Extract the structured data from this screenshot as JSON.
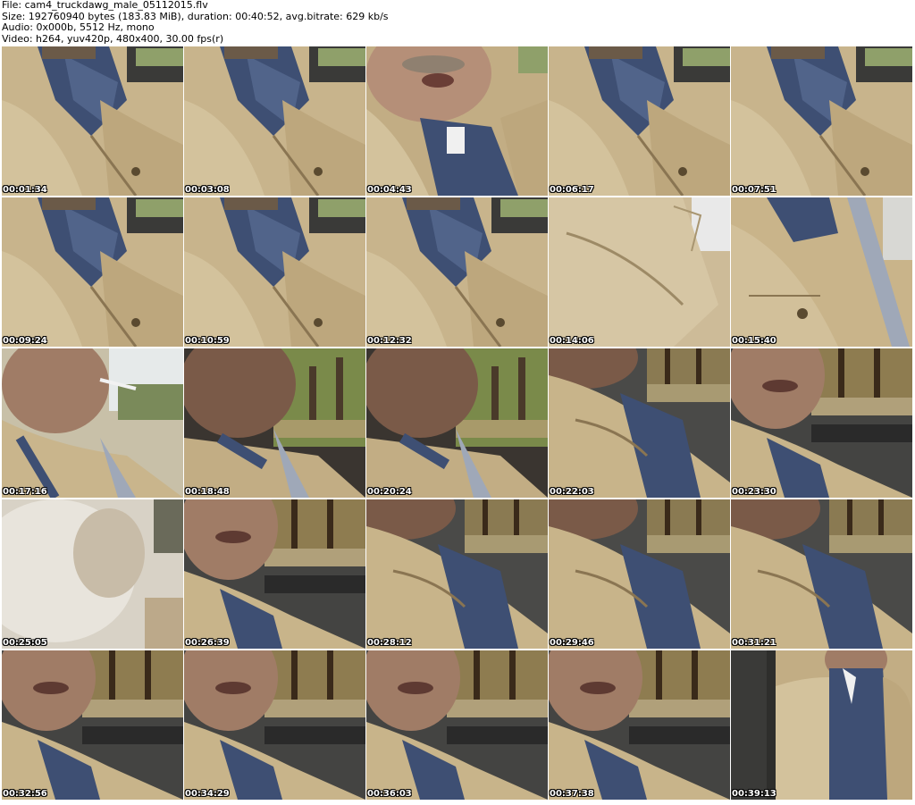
{
  "header": {
    "file_line": "File: cam4_truckdawg_male_05112015.flv",
    "size_line": "Size: 192760940 bytes (183.83 MiB), duration: 00:40:52, avg.bitrate: 629 kb/s",
    "audio_line": "Audio: 0x000b, 5512 Hz, mono",
    "video_line": "Video: h264, yuv420p, 480x400, 30.00 fps(r)"
  },
  "thumbnails": [
    {
      "time": "00:01:34",
      "scene": "jacket-window"
    },
    {
      "time": "00:03:08",
      "scene": "jacket-window"
    },
    {
      "time": "00:04:43",
      "scene": "face-jacket"
    },
    {
      "time": "00:06:17",
      "scene": "jacket-window"
    },
    {
      "time": "00:07:51",
      "scene": "jacket-window"
    },
    {
      "time": "00:09:24",
      "scene": "jacket-window"
    },
    {
      "time": "00:10:59",
      "scene": "jacket-window"
    },
    {
      "time": "00:12:32",
      "scene": "jacket-window"
    },
    {
      "time": "00:14:06",
      "scene": "jacket-close"
    },
    {
      "time": "00:15:40",
      "scene": "jacket-belt"
    },
    {
      "time": "00:17:16",
      "scene": "profile-sky"
    },
    {
      "time": "00:18:48",
      "scene": "profile-trees"
    },
    {
      "time": "00:20:24",
      "scene": "profile-trees"
    },
    {
      "time": "00:22:03",
      "scene": "jacket-park"
    },
    {
      "time": "00:23:30",
      "scene": "face-park"
    },
    {
      "time": "00:25:05",
      "scene": "blur"
    },
    {
      "time": "00:26:39",
      "scene": "face-park"
    },
    {
      "time": "00:28:12",
      "scene": "jacket-park"
    },
    {
      "time": "00:29:46",
      "scene": "jacket-park"
    },
    {
      "time": "00:31:21",
      "scene": "jacket-park"
    },
    {
      "time": "00:32:56",
      "scene": "face-park"
    },
    {
      "time": "00:34:29",
      "scene": "face-park"
    },
    {
      "time": "00:36:03",
      "scene": "face-park"
    },
    {
      "time": "00:37:38",
      "scene": "face-park"
    },
    {
      "time": "00:39:13",
      "scene": "standing"
    }
  ]
}
